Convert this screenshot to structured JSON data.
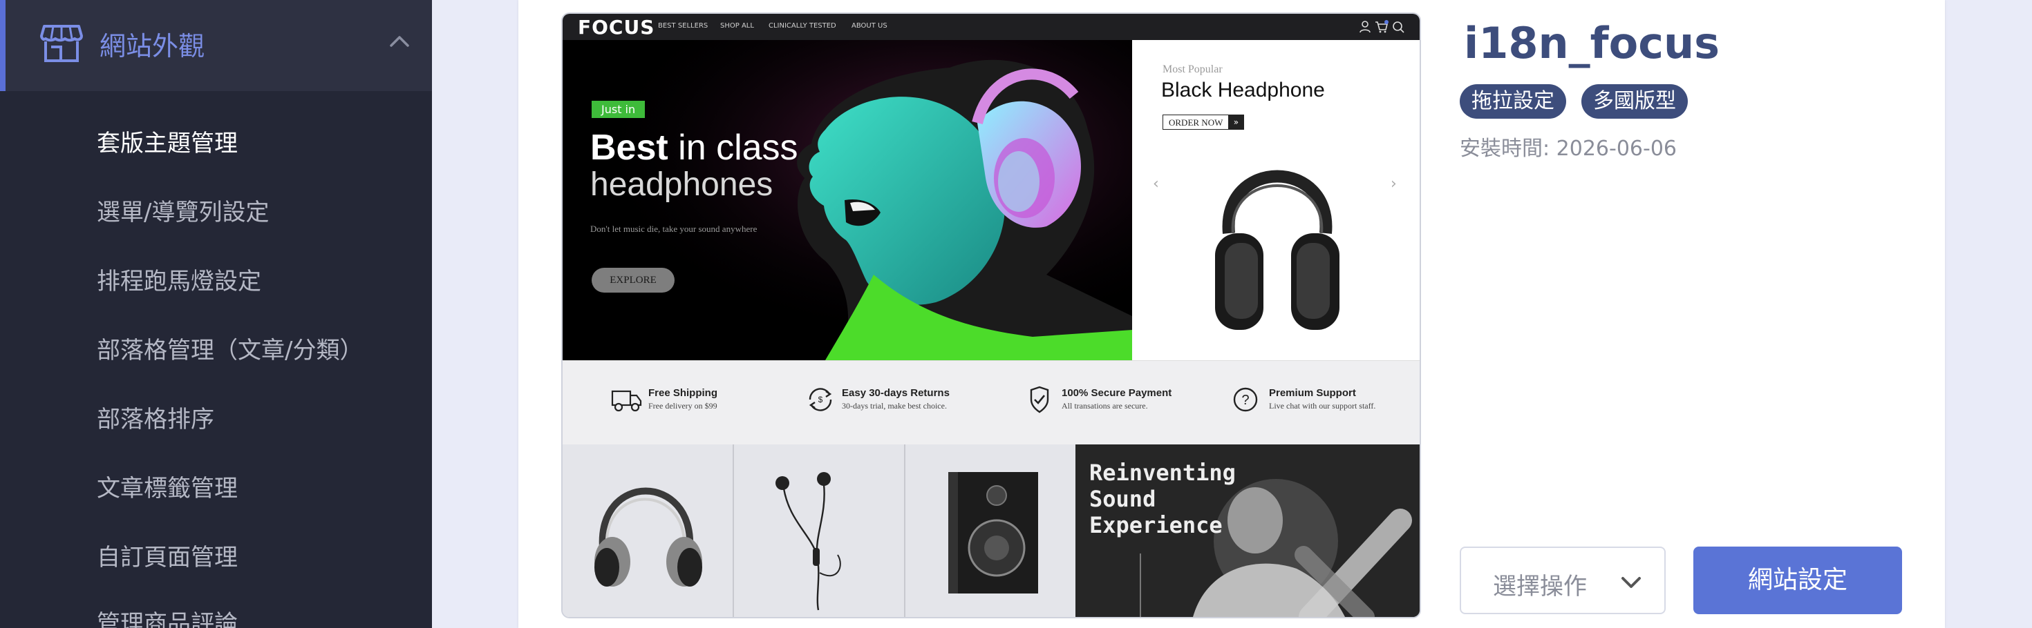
{
  "sidebar": {
    "header_title": "網站外觀",
    "items": [
      {
        "label": "套版主題管理",
        "active": true
      },
      {
        "label": "選單/導覽列設定"
      },
      {
        "label": "排程跑馬燈設定"
      },
      {
        "label": "部落格管理（文章/分類）"
      },
      {
        "label": "部落格排序"
      },
      {
        "label": "文章標籤管理"
      },
      {
        "label": "自訂頁面管理"
      },
      {
        "label": "管理商品評論"
      }
    ]
  },
  "theme": {
    "name": "i18n_focus",
    "tags": [
      "拖拉設定",
      "多國版型"
    ],
    "install_date": "安裝時間: 2026-06-06",
    "select_action_label": "選擇操作",
    "settings_button": "網站設定"
  },
  "preview": {
    "logo": "FOCUS",
    "nav_links": [
      "BEST SELLERS",
      "SHOP ALL",
      "CLINICALLY TESTED",
      "ABOUT US"
    ],
    "hero": {
      "badge": "Just in",
      "headline_bold": "Best",
      "headline_rest": " in class",
      "headline_line2": "headphones",
      "subtext": "Don't let music die, take your sound anywhere",
      "button": "EXPLORE"
    },
    "most_popular": {
      "label": "Most Popular",
      "title": "Black Headphone",
      "order_button": "ORDER NOW"
    },
    "features": [
      {
        "title": "Free Shipping",
        "sub": "Free delivery on $99"
      },
      {
        "title": "Easy 30-days Returns",
        "sub": "30-days trial, make best choice."
      },
      {
        "title": "100% Secure Payment",
        "sub": "All transations are secure."
      },
      {
        "title": "Premium Support",
        "sub": "Live chat with our support staff."
      }
    ],
    "promo": {
      "line1": "Reinventing",
      "line2": "Sound",
      "line3": "Experience"
    }
  },
  "colors": {
    "sidebar_bg": "#242736",
    "accent": "#5a74d6",
    "title": "#3d4d7c"
  }
}
